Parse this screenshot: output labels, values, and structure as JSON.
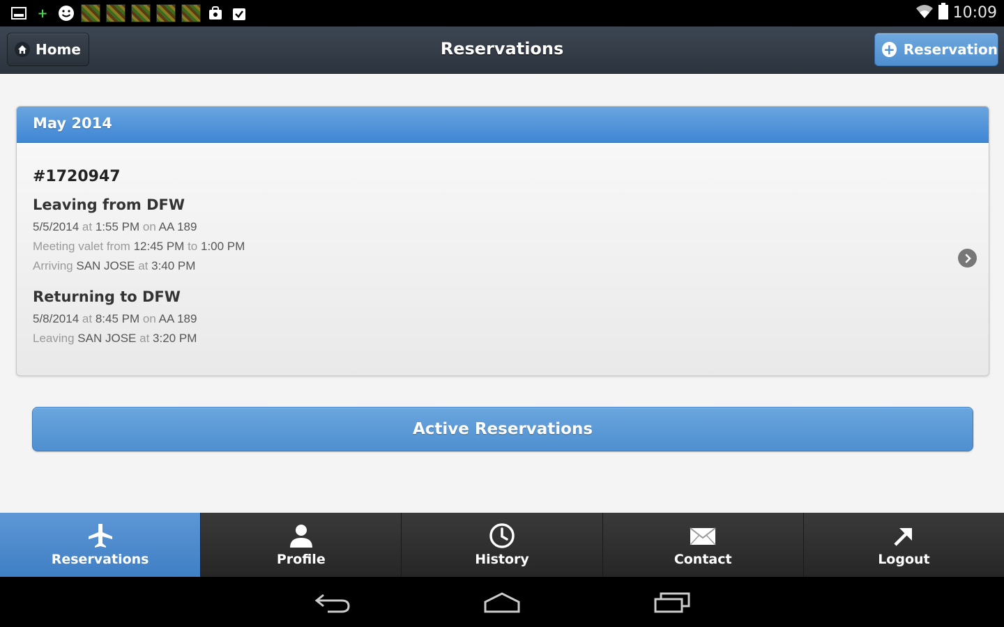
{
  "status_bar": {
    "time": "10:09"
  },
  "header": {
    "home_label": "Home",
    "title": "Reservations",
    "new_reservation_label": "Reservation"
  },
  "card": {
    "month": "May 2014",
    "reservation_number": "#1720947",
    "leaving": {
      "title": "Leaving from DFW",
      "date": "5/5/2014",
      "at1": "at",
      "time": "1:55 PM",
      "on": "on",
      "flight": "AA 189",
      "meet_label": "Meeting valet from",
      "meet_from": "12:45 PM",
      "to": "to",
      "meet_to": "1:00 PM",
      "arriving_label": "Arriving",
      "arriving_city": "SAN JOSE",
      "at2": "at",
      "arriving_time": "3:40 PM"
    },
    "returning": {
      "title": "Returning to DFW",
      "date": "5/8/2014",
      "at1": "at",
      "time": "8:45 PM",
      "on": "on",
      "flight": "AA 189",
      "leaving_label": "Leaving",
      "leaving_city": "SAN JOSE",
      "at2": "at",
      "leaving_time": "3:20 PM"
    }
  },
  "active_button_label": "Active Reservations",
  "tabs": {
    "reservations": "Reservations",
    "profile": "Profile",
    "history": "History",
    "contact": "Contact",
    "logout": "Logout"
  },
  "colors": {
    "accent": "#4f8fd0",
    "header_bg": "#323b45",
    "tabbar_bg": "#2e2e2e"
  }
}
